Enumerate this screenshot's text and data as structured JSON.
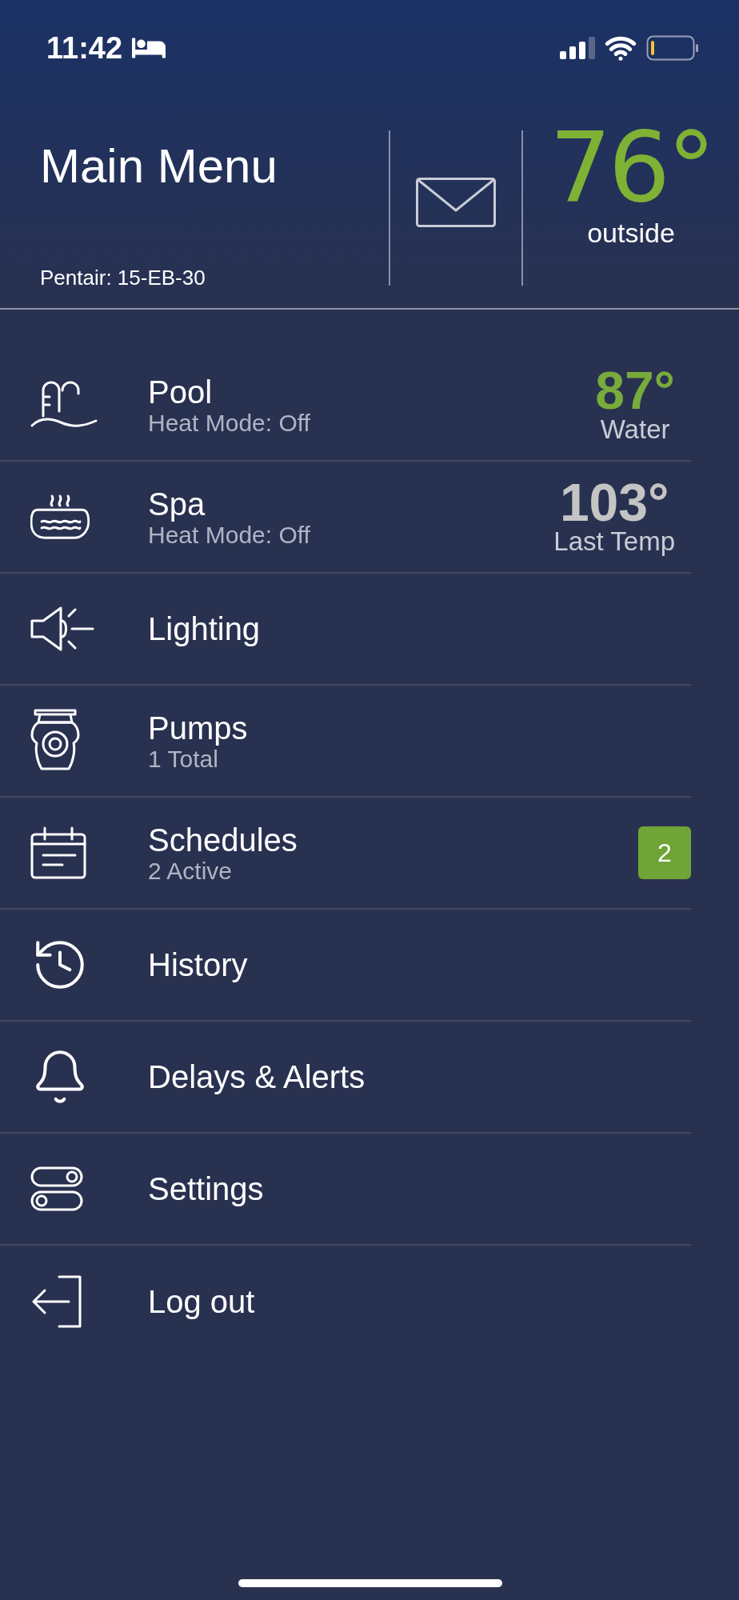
{
  "status_bar": {
    "time": "11:42"
  },
  "header": {
    "title": "Main Menu",
    "subtitle": "Pentair: 15-EB-30",
    "outside_temp": "76°",
    "outside_label": "outside"
  },
  "menu": [
    {
      "title": "Pool",
      "subtitle": "Heat Mode: Off",
      "temp": {
        "value": "87°",
        "label": "Water",
        "color": "#77ab3c"
      }
    },
    {
      "title": "Spa",
      "subtitle": "Heat Mode: Off",
      "temp": {
        "value": "103°",
        "label": "Last Temp",
        "color": "#c4c4c4"
      }
    },
    {
      "title": "Lighting"
    },
    {
      "title": "Pumps",
      "subtitle": "1 Total"
    },
    {
      "title": "Schedules",
      "subtitle": "2 Active",
      "badge": "2"
    },
    {
      "title": "History"
    },
    {
      "title": "Delays & Alerts"
    },
    {
      "title": "Settings"
    },
    {
      "title": "Log out"
    }
  ]
}
